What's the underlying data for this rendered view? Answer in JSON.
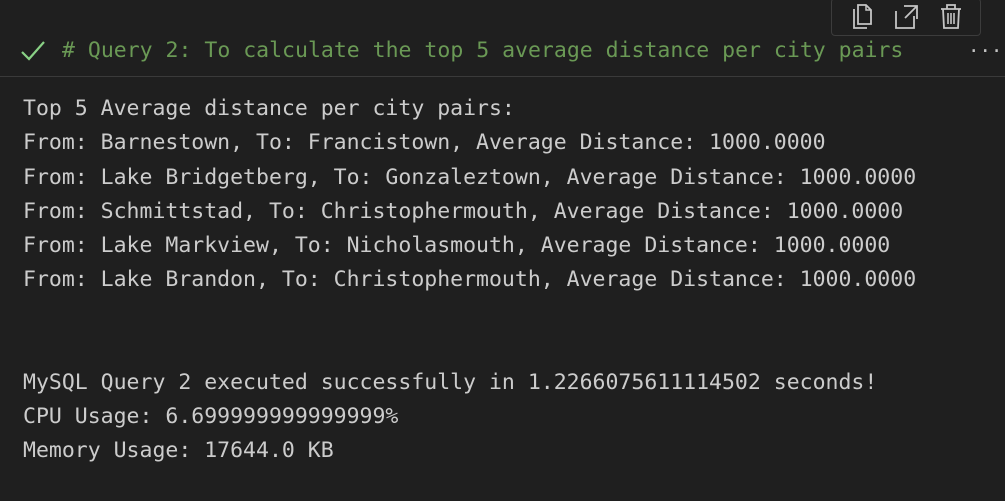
{
  "toolbar": {
    "copy_icon": "copy-icon",
    "export_icon": "open-in-editor-icon",
    "delete_icon": "trash-icon"
  },
  "cell": {
    "status_icon": "check-icon",
    "title": "# Query 2: To calculate the top 5 average distance per city pairs",
    "more": "···"
  },
  "output": {
    "header": "Top 5 Average distance per city pairs:",
    "rows": [
      "From: Barnestown, To: Francistown, Average Distance: 1000.0000",
      "From: Lake Bridgetberg, To: Gonzaleztown, Average Distance: 1000.0000",
      "From: Schmittstad, To: Christophermouth, Average Distance: 1000.0000",
      "From: Lake Markview, To: Nicholasmouth, Average Distance: 1000.0000",
      "From: Lake Brandon, To: Christophermouth, Average Distance: 1000.0000"
    ],
    "summary": "MySQL Query 2 executed successfully in 1.2266075611114502 seconds!",
    "cpu": "CPU Usage: 6.699999999999999%",
    "memory": "Memory Usage: 17644.0 KB"
  },
  "colors": {
    "background": "#1f1f1f",
    "comment_green": "#6a9955",
    "check_green": "#89d185",
    "output_text": "#cccccc"
  }
}
